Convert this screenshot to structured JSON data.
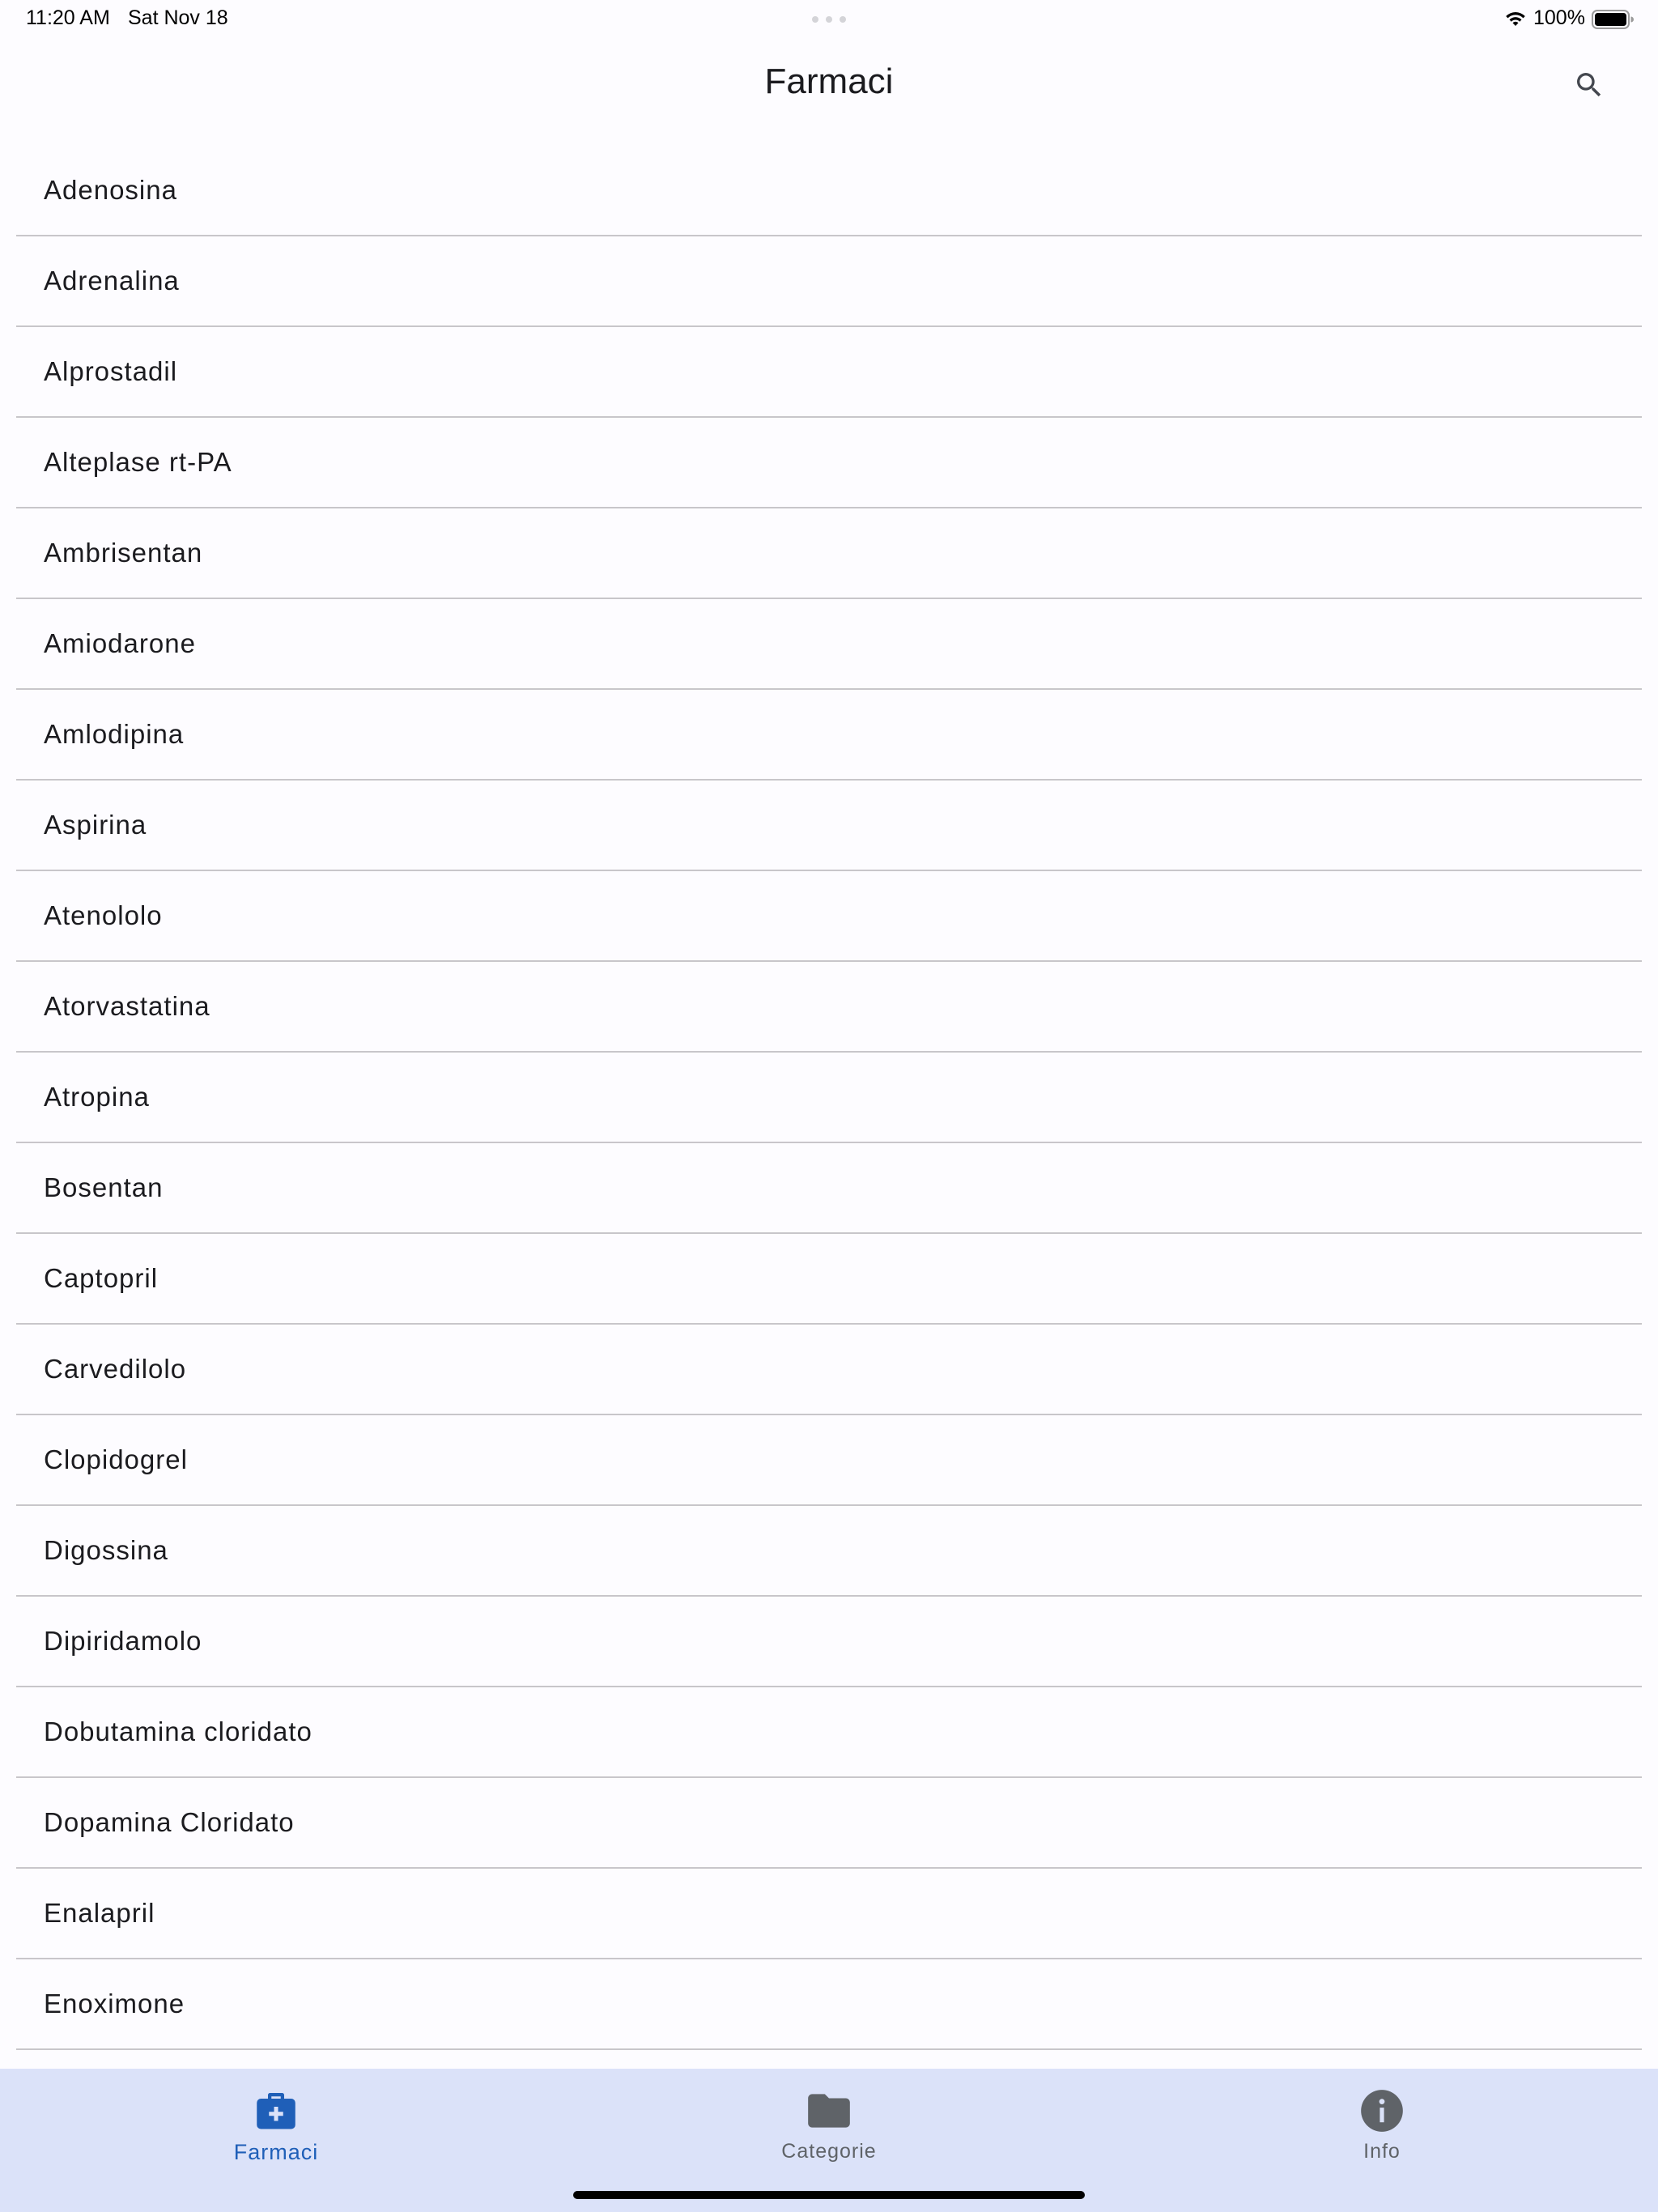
{
  "status_bar": {
    "time": "11:20 AM",
    "date": "Sat Nov 18",
    "battery": "100%"
  },
  "app_bar": {
    "title": "Farmaci",
    "search_icon": "search-icon"
  },
  "drugs": [
    "Adenosina",
    "Adrenalina",
    "Alprostadil",
    "Alteplase rt-PA",
    "Ambrisentan",
    "Amiodarone",
    "Amlodipina",
    "Aspirina",
    "Atenololo",
    "Atorvastatina",
    "Atropina",
    "Bosentan",
    "Captopril",
    "Carvedilolo",
    "Clopidogrel",
    "Digossina",
    "Dipiridamolo",
    "Dobutamina cloridato",
    "Dopamina Cloridato",
    "Enalapril",
    "Enoximone"
  ],
  "bottom_nav": {
    "items": [
      {
        "label": "Farmaci",
        "icon": "medical-kit-icon",
        "active": true
      },
      {
        "label": "Categorie",
        "icon": "folder-icon",
        "active": false
      },
      {
        "label": "Info",
        "icon": "info-icon",
        "active": false
      }
    ],
    "active_color": "#1f5fb8",
    "inactive_color": "#5f6368",
    "background": "#dbe2f9"
  }
}
